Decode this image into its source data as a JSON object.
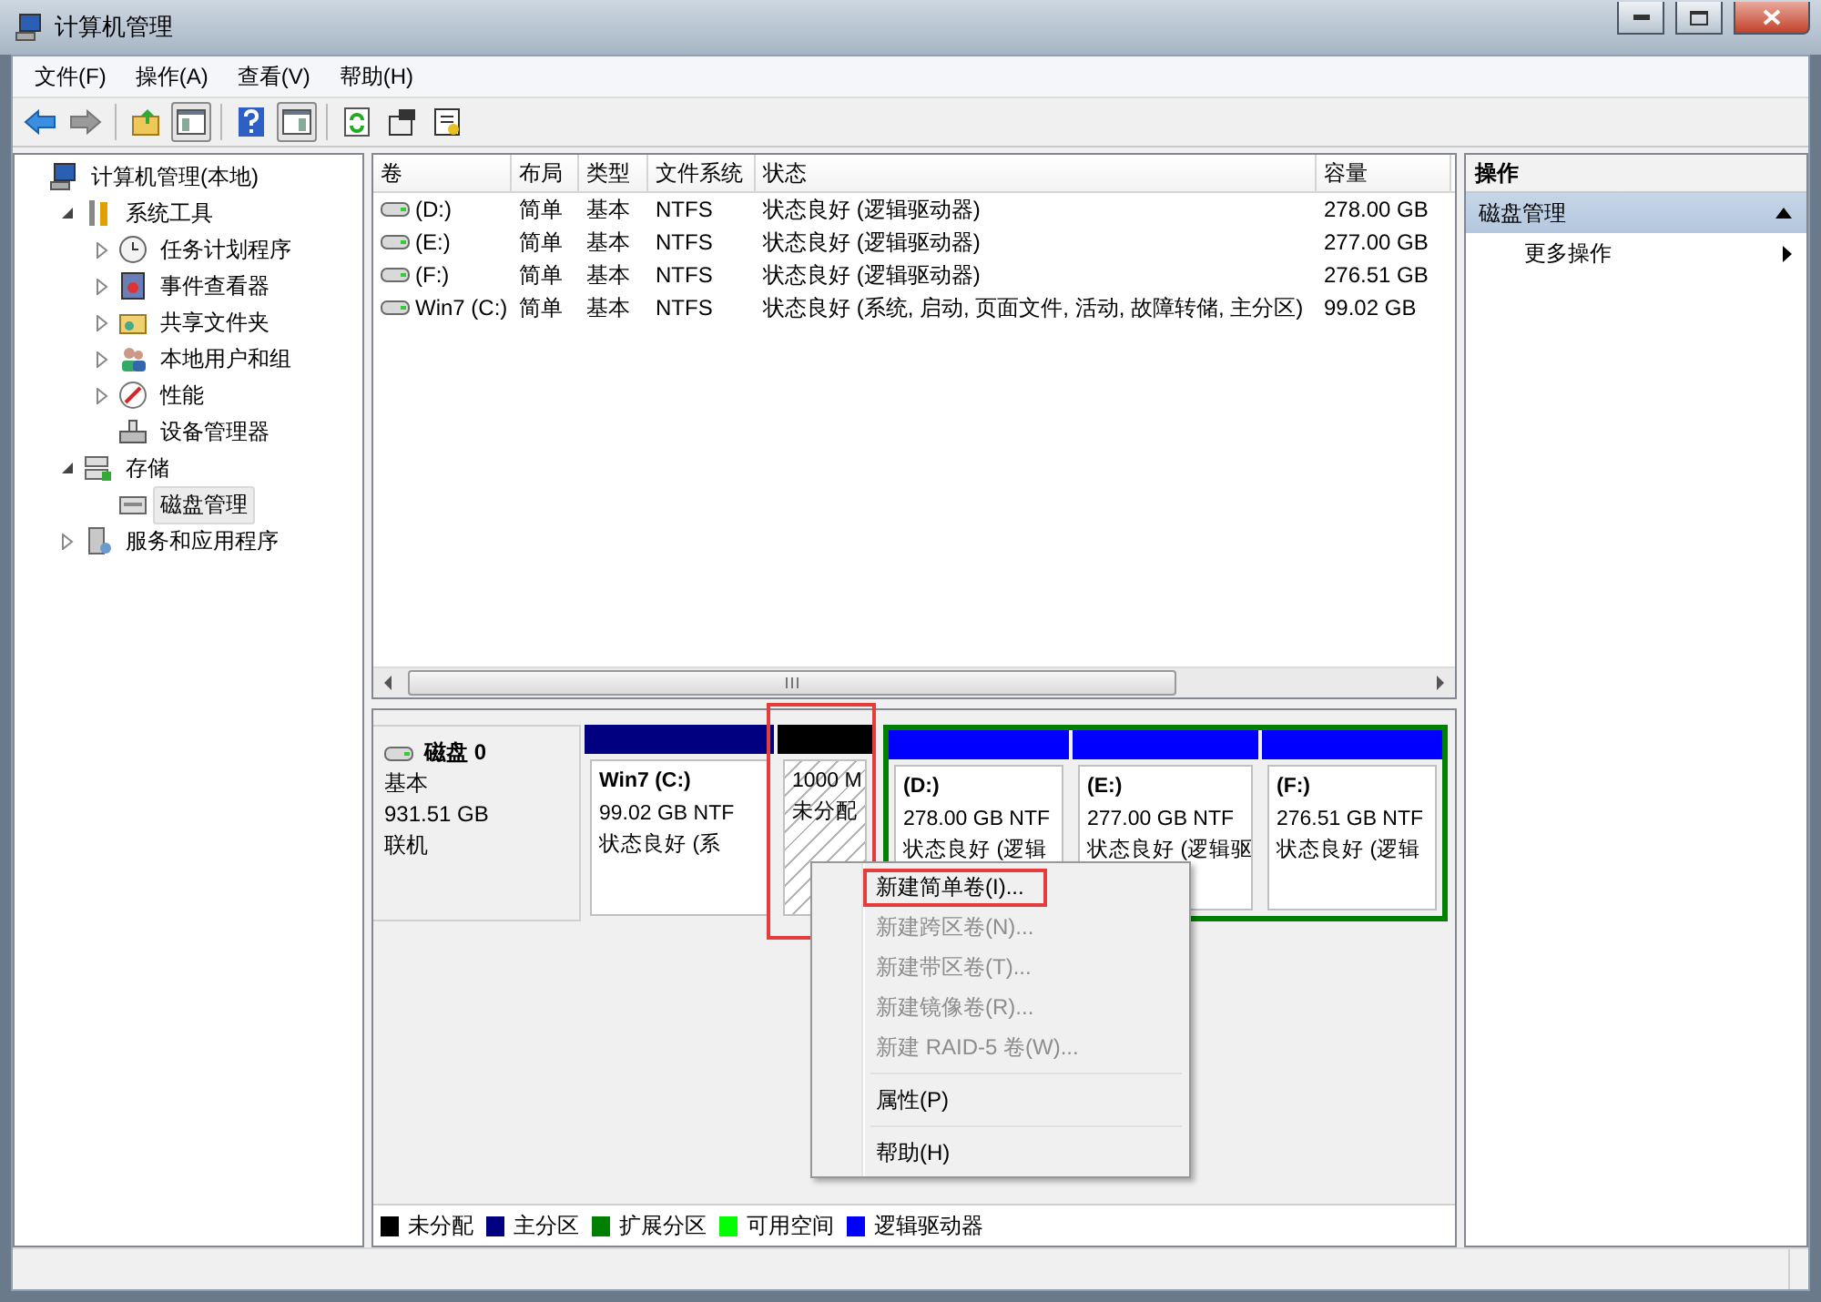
{
  "window": {
    "title": "计算机管理"
  },
  "menu_bar": [
    "文件(F)",
    "操作(A)",
    "查看(V)",
    "帮助(H)"
  ],
  "tree": [
    {
      "label": "计算机管理(本地)",
      "selected": false,
      "children": [
        {
          "label": "系统工具",
          "expanded": true,
          "selected": false,
          "children": [
            {
              "label": "任务计划程序",
              "expanded": false,
              "selected": false
            },
            {
              "label": "事件查看器",
              "expanded": false,
              "selected": false
            },
            {
              "label": "共享文件夹",
              "expanded": false,
              "selected": false
            },
            {
              "label": "本地用户和组",
              "expanded": false,
              "selected": false
            },
            {
              "label": "性能",
              "expanded": false,
              "selected": false
            },
            {
              "label": "设备管理器",
              "selected": false
            }
          ]
        },
        {
          "label": "存储",
          "expanded": true,
          "selected": false,
          "children": [
            {
              "label": "磁盘管理",
              "selected": true
            }
          ]
        },
        {
          "label": "服务和应用程序",
          "expanded": false,
          "selected": false
        }
      ]
    }
  ],
  "table": {
    "columns": [
      "卷",
      "布局",
      "类型",
      "文件系统",
      "状态",
      "容量"
    ],
    "rows": [
      {
        "cells": [
          "(D:)",
          "简单",
          "基本",
          "NTFS",
          "状态良好 (逻辑驱动器)",
          "278.00 GB"
        ]
      },
      {
        "cells": [
          "(E:)",
          "简单",
          "基本",
          "NTFS",
          "状态良好 (逻辑驱动器)",
          "277.00 GB"
        ]
      },
      {
        "cells": [
          "(F:)",
          "简单",
          "基本",
          "NTFS",
          "状态良好 (逻辑驱动器)",
          "276.51 GB"
        ]
      },
      {
        "cells": [
          "Win7 (C:)",
          "简单",
          "基本",
          "NTFS",
          "状态良好 (系统, 启动, 页面文件, 活动, 故障转储, 主分区)",
          "99.02 GB"
        ]
      }
    ]
  },
  "disk": {
    "name": "磁盘 0",
    "type": "基本",
    "size": "931.51 GB",
    "status": "联机",
    "partitions": [
      {
        "kind": "volume",
        "color": "#000080",
        "label": "Win7  (C:)",
        "size": "99.02 GB NTF",
        "status": "状态良好 (系"
      },
      {
        "kind": "unallocated",
        "color": "#000000",
        "size": "1000 M",
        "status": "未分配",
        "annotated": true
      },
      {
        "kind": "extended",
        "children": [
          {
            "kind": "volume",
            "color": "#0000ff",
            "label": "(D:)",
            "size": "278.00 GB NTF",
            "status": "状态良好 (逻辑"
          },
          {
            "kind": "volume",
            "color": "#0000ff",
            "label": "(E:)",
            "size": "277.00 GB NTF",
            "status": "状态良好 (逻辑驱"
          },
          {
            "kind": "volume",
            "color": "#0000ff",
            "label": "(F:)",
            "size": "276.51 GB NTF",
            "status": "状态良好 (逻辑"
          }
        ]
      }
    ]
  },
  "legend": [
    {
      "label": "未分配",
      "color": "#000000"
    },
    {
      "label": "主分区",
      "color": "#000080"
    },
    {
      "label": "扩展分区",
      "color": "#008000"
    },
    {
      "label": "可用空间",
      "color": "#00ff00"
    },
    {
      "label": "逻辑驱动器",
      "color": "#0000ff"
    }
  ],
  "context_menu": {
    "groups": [
      [
        {
          "label": "新建简单卷(I)...",
          "disabled": false,
          "annotated": true
        },
        {
          "label": "新建跨区卷(N)...",
          "disabled": true,
          "annotated": false
        },
        {
          "label": "新建带区卷(T)...",
          "disabled": true,
          "annotated": false
        },
        {
          "label": "新建镜像卷(R)...",
          "disabled": true,
          "annotated": false
        },
        {
          "label": "新建 RAID-5 卷(W)...",
          "disabled": true,
          "annotated": false
        }
      ],
      [
        {
          "label": "属性(P)",
          "disabled": false,
          "annotated": false
        }
      ],
      [
        {
          "label": "帮助(H)",
          "disabled": false,
          "annotated": false
        }
      ]
    ]
  },
  "actions": {
    "header": "操作",
    "sections": [
      {
        "title": "磁盘管理",
        "expanded": true,
        "items": [
          "更多操作"
        ]
      }
    ]
  }
}
